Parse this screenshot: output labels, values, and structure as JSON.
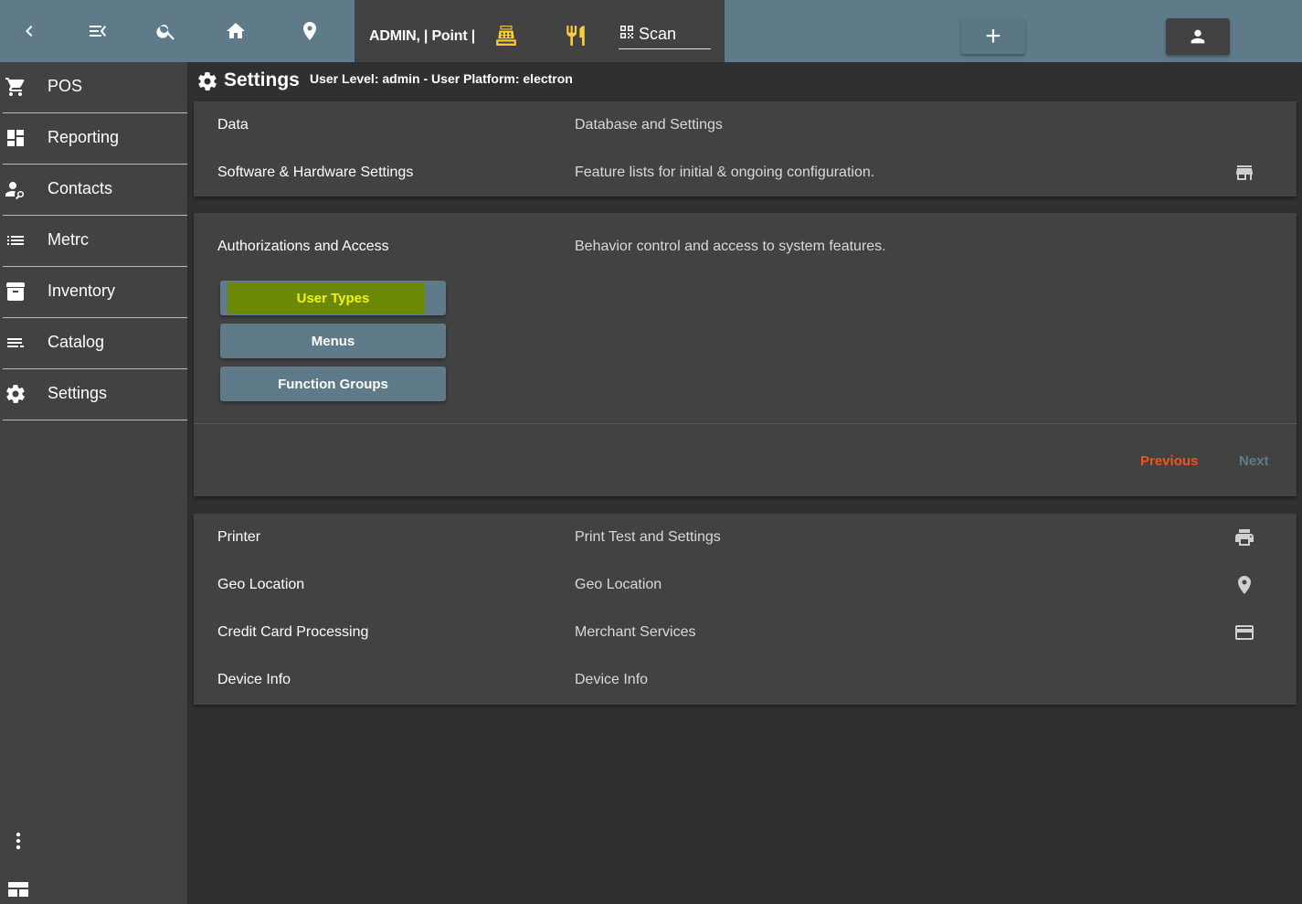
{
  "topbar": {
    "icons": [
      "chevron-left-icon",
      "menu-collapse-icon",
      "search-icon",
      "home-icon",
      "map-pin-icon"
    ],
    "admin_label": "ADMIN, | Point |",
    "register_icon": "cash-register-icon",
    "food_icon": "fork-knife-icon",
    "scan_label": "Scan",
    "plus_label": "+",
    "colors": {
      "bar": "#5f7b8a",
      "dark": "#424242",
      "accent": "#ffcd3a"
    }
  },
  "sidebar": {
    "items": [
      {
        "label": "POS",
        "icon": "cart-icon"
      },
      {
        "label": "Reporting",
        "icon": "dashboard-icon"
      },
      {
        "label": "Contacts",
        "icon": "contact-search-icon"
      },
      {
        "label": "Metrc",
        "icon": "list-icon"
      },
      {
        "label": "Inventory",
        "icon": "archive-icon"
      },
      {
        "label": "Catalog",
        "icon": "catalog-icon"
      },
      {
        "label": "Settings",
        "icon": "gear-icon"
      }
    ]
  },
  "header": {
    "title": "Settings",
    "subtitle": "User Level: admin - User Platform: electron"
  },
  "card1": {
    "rows": [
      {
        "name": "Data",
        "desc": "Database and Settings"
      },
      {
        "name": "Software & Hardware Settings",
        "desc": "Feature lists for initial & ongoing configuration."
      }
    ]
  },
  "auth": {
    "title": "Authorizations and Access",
    "desc": "Behavior control and access to system features.",
    "buttons": [
      "User Types",
      "Menus",
      "Function Groups"
    ],
    "previous": "Previous",
    "next": "Next",
    "colors": {
      "previous": "#f4511e",
      "next": "#5f7b8a",
      "highlight": "#f4f400"
    }
  },
  "card3": {
    "rows": [
      {
        "name": "Printer",
        "desc": "Print Test and Settings"
      },
      {
        "name": "Geo Location",
        "desc": "Geo Location"
      },
      {
        "name": "Credit Card Processing",
        "desc": "Merchant Services"
      },
      {
        "name": "Device Info",
        "desc": "Device Info"
      }
    ]
  }
}
